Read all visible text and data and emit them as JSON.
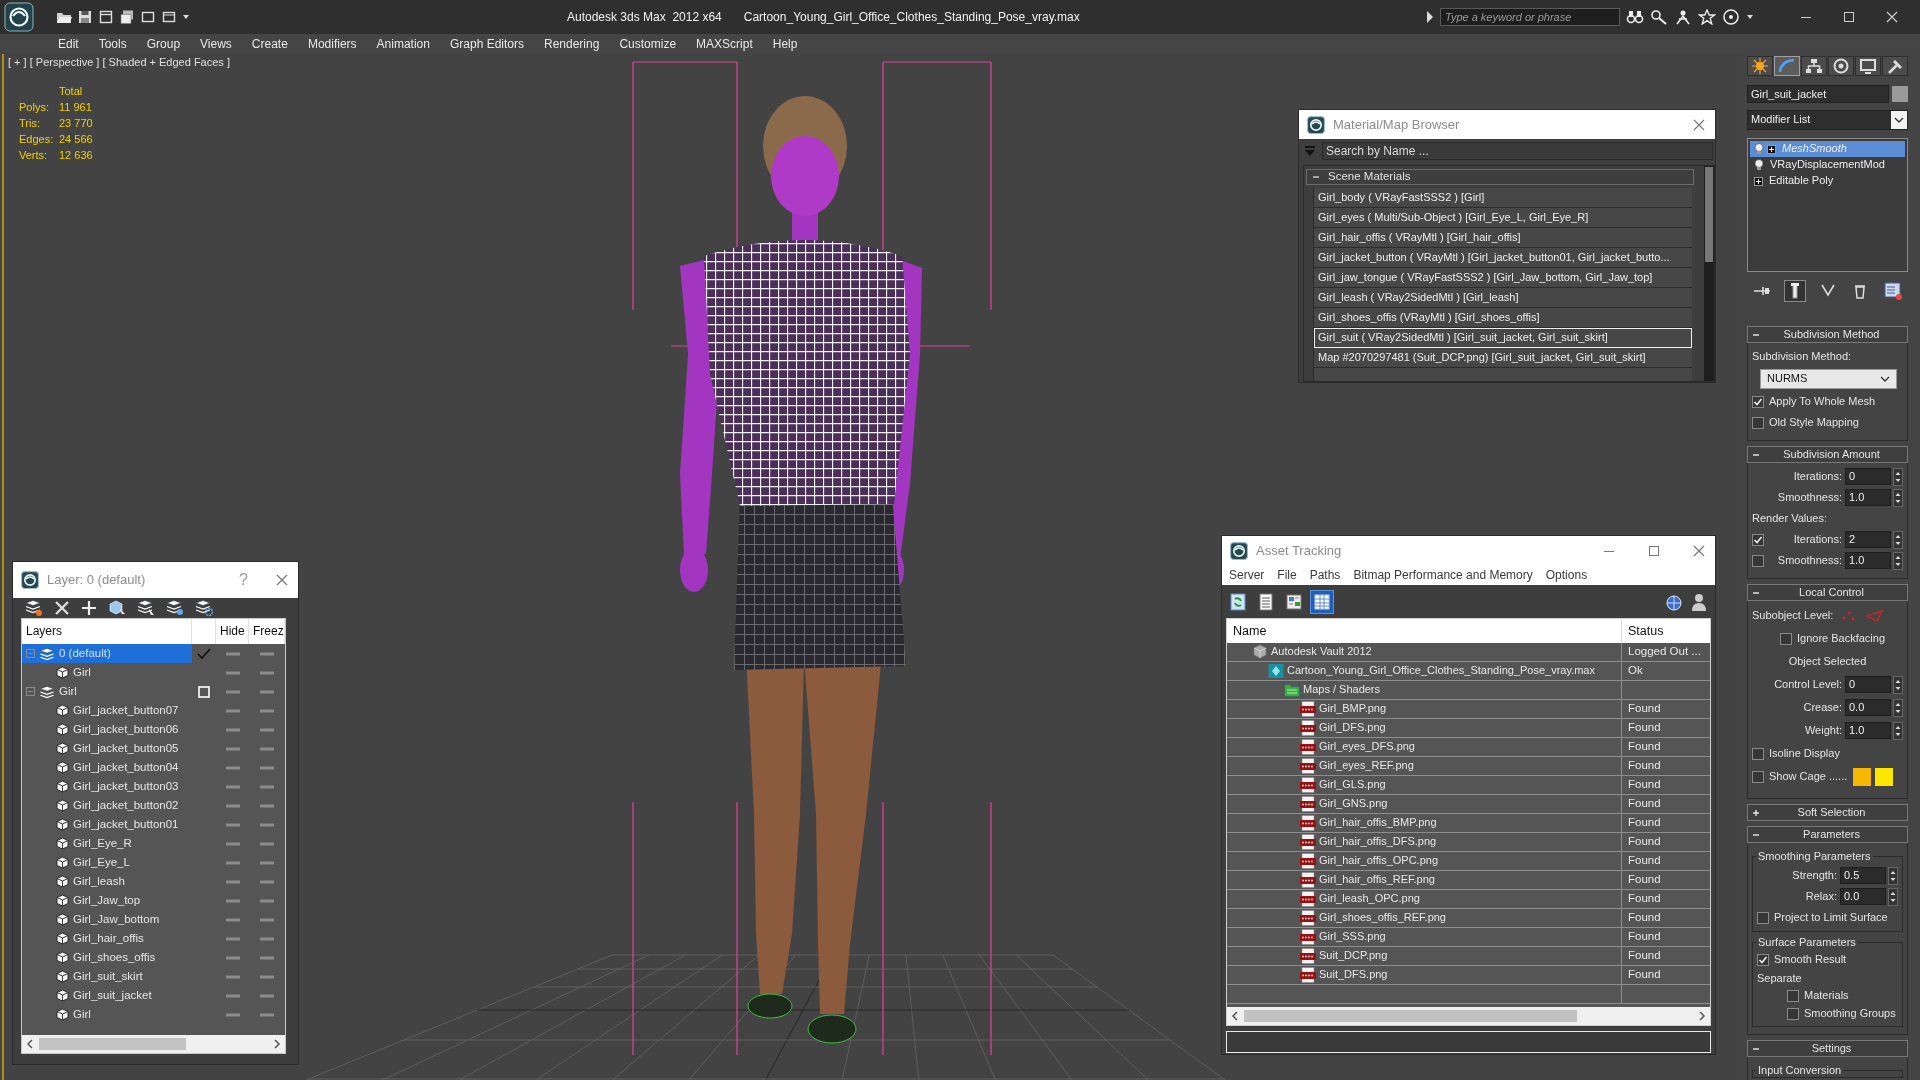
{
  "title_bar": {
    "app_title": "Autodesk 3ds Max  2012 x64",
    "file_name": "Cartoon_Young_Girl_Office_Clothes_Standing_Pose_vray.max",
    "search_placeholder": "Type a keyword or phrase"
  },
  "menu": [
    "Edit",
    "Tools",
    "Group",
    "Views",
    "Create",
    "Modifiers",
    "Animation",
    "Graph Editors",
    "Rendering",
    "Customize",
    "MAXScript",
    "Help"
  ],
  "viewport": {
    "label": "[ + ] [ Perspective ] [ Shaded + Edged Faces ]",
    "stats_header": "Total",
    "stats": [
      {
        "label": "Polys:",
        "value": "11 961"
      },
      {
        "label": "Tris:",
        "value": "23 770"
      },
      {
        "label": "Edges:",
        "value": "24 566"
      },
      {
        "label": "Verts:",
        "value": "12 636"
      }
    ]
  },
  "layer_window": {
    "title": "Layer: 0 (default)",
    "help": "?",
    "columns": [
      "Layers",
      "Hide",
      "Freez"
    ],
    "layers": [
      {
        "name": "0 (default)",
        "selected": true,
        "current": true,
        "expanded": true,
        "children": [
          {
            "name": "Girl"
          }
        ]
      },
      {
        "name": "Girl",
        "selected": false,
        "current": false,
        "expanded": true,
        "children": [
          {
            "name": "Girl_jacket_button07"
          },
          {
            "name": "Girl_jacket_button06"
          },
          {
            "name": "Girl_jacket_button05"
          },
          {
            "name": "Girl_jacket_button04"
          },
          {
            "name": "Girl_jacket_button03"
          },
          {
            "name": "Girl_jacket_button02"
          },
          {
            "name": "Girl_jacket_button01"
          },
          {
            "name": "Girl_Eye_R"
          },
          {
            "name": "Girl_Eye_L"
          },
          {
            "name": "Girl_leash"
          },
          {
            "name": "Girl_Jaw_top"
          },
          {
            "name": "Girl_Jaw_bottom"
          },
          {
            "name": "Girl_hair_offis"
          },
          {
            "name": "Girl_shoes_offis"
          },
          {
            "name": "Girl_suit_skirt"
          },
          {
            "name": "Girl_suit_jacket"
          },
          {
            "name": "Girl"
          }
        ]
      }
    ]
  },
  "material_browser": {
    "title": "Material/Map Browser",
    "search_placeholder": "Search by Name ...",
    "section": {
      "title": "Scene Materials",
      "expanded": true,
      "items": [
        {
          "text": "Girl_body ( VRayFastSSS2 ) [Girl]",
          "selected": false
        },
        {
          "text": "Girl_eyes ( Multi/Sub-Object ) [Girl_Eye_L, Girl_Eye_R]",
          "selected": false
        },
        {
          "text": "Girl_hair_offis ( VRayMtl ) [Girl_hair_offis]",
          "selected": false
        },
        {
          "text": "Girl_jacket_button ( VRayMtl ) [Girl_jacket_button01, Girl_jacket_butto...",
          "selected": false
        },
        {
          "text": "Girl_jaw_tongue ( VRayFastSSS2 ) [Girl_Jaw_bottom, Girl_Jaw_top]",
          "selected": false
        },
        {
          "text": "Girl_leash ( VRay2SidedMtl ) [Girl_leash]",
          "selected": false
        },
        {
          "text": "Girl_shoes_offis (VRayMtl ) [Girl_shoes_offis]",
          "selected": false
        },
        {
          "text": "Girl_suit ( VRay2SidedMtl ) [Girl_suit_jacket, Girl_suit_skirt]",
          "selected": true
        },
        {
          "text": "Map #2070297481 (Suit_DCP.png) [Girl_suit_jacket, Girl_suit_skirt]",
          "selected": false
        }
      ]
    }
  },
  "asset_tracking": {
    "title": "Asset Tracking",
    "menu": [
      "Server",
      "File",
      "Paths",
      "Bitmap Performance and Memory",
      "Options"
    ],
    "view_buttons": [
      {
        "kind": "refresh",
        "selected": false
      },
      {
        "kind": "list",
        "selected": false
      },
      {
        "kind": "thumbnails",
        "selected": false
      },
      {
        "kind": "table",
        "selected": true
      }
    ],
    "columns": [
      "Name",
      "Status"
    ],
    "rows": [
      {
        "kind": "vault",
        "name": "Autodesk Vault 2012",
        "status": "Logged Out ...",
        "children": [
          {
            "kind": "max_file",
            "name": "Cartoon_Young_Girl_Office_Clothes_Standing_Pose_vray.max",
            "status": "Ok",
            "children": [
              {
                "kind": "folder",
                "name": "Maps / Shaders",
                "children": [
                  {
                    "kind": "png",
                    "name": "Girl_BMP.png",
                    "status": "Found"
                  },
                  {
                    "kind": "png",
                    "name": "Girl_DFS.png",
                    "status": "Found"
                  },
                  {
                    "kind": "png",
                    "name": "Girl_eyes_DFS.png",
                    "status": "Found"
                  },
                  {
                    "kind": "png",
                    "name": "Girl_eyes_REF.png",
                    "status": "Found"
                  },
                  {
                    "kind": "png",
                    "name": "Girl_GLS.png",
                    "status": "Found"
                  },
                  {
                    "kind": "png",
                    "name": "Girl_GNS.png",
                    "status": "Found"
                  },
                  {
                    "kind": "png",
                    "name": "Girl_hair_offis_BMP.png",
                    "status": "Found"
                  },
                  {
                    "kind": "png",
                    "name": "Girl_hair_offis_DFS.png",
                    "status": "Found"
                  },
                  {
                    "kind": "png",
                    "name": "Girl_hair_offis_OPC.png",
                    "status": "Found"
                  },
                  {
                    "kind": "png",
                    "name": "Girl_hair_offis_REF.png",
                    "status": "Found"
                  },
                  {
                    "kind": "png",
                    "name": "Girl_leash_OPC.png",
                    "status": "Found"
                  },
                  {
                    "kind": "png",
                    "name": "Girl_shoes_offis_REF.png",
                    "status": "Found"
                  },
                  {
                    "kind": "png",
                    "name": "Girl_SSS.png",
                    "status": "Found"
                  },
                  {
                    "kind": "png",
                    "name": "Suit_DCP.png",
                    "status": "Found"
                  },
                  {
                    "kind": "png",
                    "name": "Suit_DFS.png",
                    "status": "Found"
                  }
                ]
              }
            ]
          }
        ]
      }
    ]
  },
  "command_panel": {
    "tabs": [
      {
        "kind": "create",
        "selected": false
      },
      {
        "kind": "modify",
        "selected": true
      },
      {
        "kind": "hierarchy",
        "selected": false
      },
      {
        "kind": "motion",
        "selected": false
      },
      {
        "kind": "display",
        "selected": false
      },
      {
        "kind": "utilities",
        "selected": false
      }
    ],
    "object_name": "Girl_suit_jacket",
    "modifier_list": "Modifier List",
    "stack": [
      {
        "name": "MeshSmooth",
        "selected": true,
        "bulb": true,
        "expandable": true
      },
      {
        "name": "VRayDisplacementMod",
        "selected": false,
        "bulb": true,
        "expandable": false
      },
      {
        "name": "Editable Poly",
        "selected": false,
        "bulb": false,
        "expandable": true
      }
    ],
    "stack_tools": [
      {
        "kind": "pin",
        "selected": false
      },
      {
        "kind": "show_end_result",
        "selected": true
      },
      {
        "kind": "make_unique",
        "selected": false
      },
      {
        "kind": "remove",
        "selected": false
      },
      {
        "kind": "configure",
        "selected": false
      }
    ],
    "rollouts": [
      {
        "title": "Subdivision Method",
        "expanded": true,
        "controls": [
          {
            "kind": "label",
            "text": "Subdivision Method:"
          },
          {
            "kind": "dropdown",
            "value": "NURMS"
          },
          {
            "kind": "checkbox",
            "label": "Apply To Whole Mesh",
            "checked": true
          },
          {
            "kind": "checkbox",
            "label": "Old Style Mapping",
            "checked": false
          }
        ]
      },
      {
        "title": "Subdivision Amount",
        "expanded": true,
        "controls": [
          {
            "kind": "spinner",
            "label": "Iterations:",
            "value": "0"
          },
          {
            "kind": "spinner",
            "label": "Smoothness:",
            "value": "1.0"
          },
          {
            "kind": "label",
            "text": "Render Values:"
          },
          {
            "kind": "checkspinner",
            "label": "Iterations:",
            "value": "2",
            "checked": true
          },
          {
            "kind": "checkspinner",
            "label": "Smoothness:",
            "value": "1.0",
            "checked": false
          }
        ]
      },
      {
        "title": "Local Control",
        "expanded": true,
        "controls": [
          {
            "kind": "subobject",
            "label": "Subobject Level:"
          },
          {
            "kind": "centercheckbox",
            "label": "Ignore Backfacing",
            "checked": false
          },
          {
            "kind": "text",
            "text": "Object Selected"
          },
          {
            "kind": "spinner",
            "label": "Control Level:",
            "value": "0"
          },
          {
            "kind": "spinner",
            "label": "Crease:",
            "value": "0.0"
          },
          {
            "kind": "spinner",
            "label": "Weight:",
            "value": "1.0"
          },
          {
            "kind": "checkbox",
            "label": "Isoline Display",
            "checked": false
          },
          {
            "kind": "cage",
            "label": "Show Cage ......",
            "checked": false,
            "swatches": [
              {
                "color": "#f5b700"
              },
              {
                "color": "#ffe600"
              }
            ]
          }
        ]
      },
      {
        "title": "Soft Selection",
        "expanded": false
      },
      {
        "title": "Parameters",
        "expanded": true,
        "controls": [
          {
            "kind": "group",
            "title": "Smoothing Parameters",
            "controls": [
              {
                "kind": "spinner",
                "label": "Strength:",
                "value": "0.5"
              },
              {
                "kind": "spinner",
                "label": "Relax:",
                "value": "0.0"
              },
              {
                "kind": "checkbox",
                "label": "Project to Limit Surface",
                "checked": false
              }
            ]
          },
          {
            "kind": "group",
            "title": "Surface Parameters",
            "controls": [
              {
                "kind": "checkbox",
                "label": "Smooth Result",
                "checked": true
              },
              {
                "kind": "label",
                "text": "Separate"
              },
              {
                "kind": "subcheckbox",
                "label": "Materials",
                "checked": false
              },
              {
                "kind": "subcheckbox",
                "label": "Smoothing Groups",
                "checked": false
              }
            ]
          }
        ]
      },
      {
        "title": "Settings",
        "expanded": true,
        "controls": [
          {
            "kind": "group",
            "title": "Input Conversion"
          }
        ]
      }
    ]
  }
}
